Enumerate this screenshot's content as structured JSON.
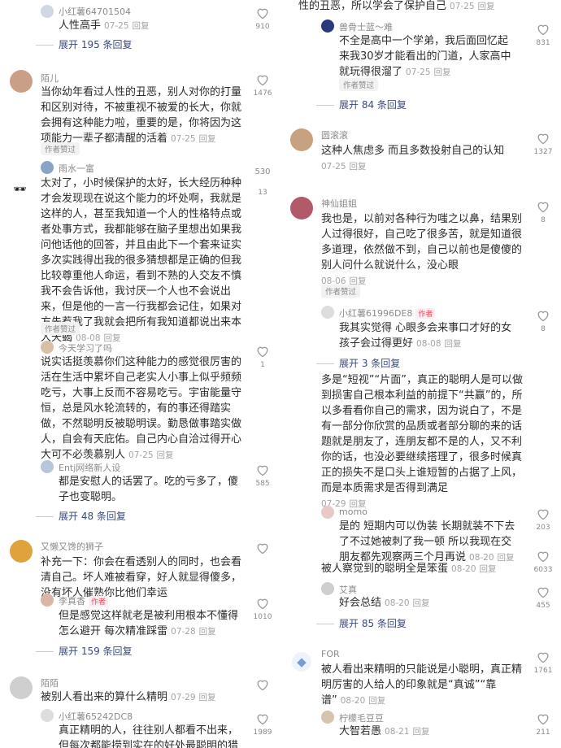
{
  "left": {
    "c0": {
      "name": "小红薯64701504",
      "text": "人性高手",
      "date": "07-25",
      "reply": "回复",
      "likes": "910",
      "expand": "展开 195 条回复"
    },
    "c1": {
      "name": "陌儿",
      "text": "当你幼年看过人性的丑恶，别人对你的打量和区别对待，不被重视不被爱的长大，你就会拥有这种能力啦，重要的是，你将因为这项能力一辈子都清醒的活着",
      "date": "07-25",
      "reply": "回复",
      "likes": "1476",
      "author_liked": "作者赞过"
    },
    "c2": {
      "name": "雨水一富",
      "text": "太对了，小时候保护的太好，长大经历种种才会发现现在说这个能力的坏处啊，我就是这样的人，甚至我知道一个人的性格特点或者处事方式，我都能够在脑子里想出如果我问他话他的回答，并且由此下一个套来证实多次实践得出我的很多猜想都是正确的但我比较尊重他人命运，看到不熟的人交友不慎我不会告诉他，我讨厌一个人也不会说出来，但是他的一言一行我都会记住，如果对方先惹我了我就会把所有我知道都说出来本人天蝎",
      "date": "08-08",
      "reply": "回复",
      "likes": "530",
      "likes2": "13",
      "author_liked": "作者赞过"
    },
    "c3": {
      "name": "今天学习了吗",
      "text": "说实话挺羡慕你们这种能力的感觉很厉害的活在生活中累坏自己老实人小事上似乎频频吃亏，大事上反而不容易吃亏。宇宙能量守恒，总是风水轮流转的，有的事还得踏实做，不然聪明反被聪明误。勤恳做事踏实做人，自会有天庇佑。自己内心自洽过得开心大可不必羡慕别人",
      "date": "07-25",
      "reply": "回复",
      "likes": "1"
    },
    "c4": {
      "name": "Entj网络新人设",
      "text": "都是安慰人的话罢了。吃的亏多了，傻子也变聪明。",
      "date": "",
      "likes": "585",
      "expand": "展开 48 条回复"
    },
    "c5": {
      "name": "又懒又馋的狮子",
      "text": "补充一下：你会在看透别人的同时，也会看清自己。坏人难被看穿，好人就显得傻多，没有坏人催熟你比他们幸运",
      "date": "",
      "likes": ""
    },
    "c6": {
      "name": "李真香",
      "author_badge": "作者",
      "text": "但是感觉这样就老是被利用根本不懂得怎么避开 每次精准踩雷",
      "date": "07-28",
      "reply": "回复",
      "likes": "1010",
      "expand": "展开 159 条回复"
    },
    "c7": {
      "name": "陌陌",
      "text": "被别人看出来的算什么精明",
      "date": "07-29",
      "reply": "回复",
      "likes": ""
    },
    "c8": {
      "name": "小红薯65242DC8",
      "text": "真正精明的人，往往别人都看不出来，但每次都能捞到实在的好处最聪明的猎",
      "likes": "1989"
    }
  },
  "right": {
    "c0": {
      "text": "性的丑恶，所以学会了保护自己",
      "date": "07-25",
      "reply": "回复"
    },
    "c1": {
      "name": "兽骨士蓝～难",
      "text": "不全是高中一个学弟，我后面回忆起来我30岁才能看出的门道，人家高中就玩得很溜了",
      "date": "07-25",
      "reply": "回复",
      "likes": "831",
      "author_liked": "作者赞过",
      "expand": "展开 84 条回复"
    },
    "c2": {
      "name": "圆滚滚",
      "text": "这种人焦虑多 而且多数投射自己的认知",
      "date": "07-25",
      "reply": "回复",
      "likes": "1327"
    },
    "c3": {
      "name": "神仙姐姐",
      "text": "我也是，以前对各种行为嗤之以鼻，结果别人过得很好，自己吃了很多苦，就是知道很多道理，依然做不到，自己以前也是傻傻的别人问什么就说什么，没心眼",
      "date": "08-06",
      "reply": "回复",
      "likes": "8",
      "author_liked": "作者赞过"
    },
    "c4": {
      "name": "小红薯61996DE8",
      "author_badge": "作者",
      "text": "我其实觉得 心眼多会来事口才好的女孩子会过得更好",
      "date": "08-08",
      "reply": "回复",
      "likes": "8",
      "expand": "展开 3 条回复"
    },
    "c5": {
      "text": "多是“短视”“片面”，真正的聪明人是可以做到损害自己根本利益的前提下“共赢”的，所以多看看你自己的需求，因为说白了，不是有一部分你欣赏的品质或者部分聊的来的话题就是朋友了，连朋友都不是的人，又不利你的话，也没必要继续搭理了，很多时候真正的损失不是口头上谁短暂的占据了上风，而是本质需求是否得到满足",
      "date": "07-29",
      "reply": "回复"
    },
    "c6": {
      "name": "momo",
      "text": "是的 短期内可以伪装 长期就装不下去了不过她被刺了我一顿 所以我现在交朋友都先观察两三个月再说",
      "date": "08-20",
      "reply": "回复",
      "likes": "203"
    },
    "c7": {
      "text": "被人察觉到的聪明全是笨蛋",
      "date": "08-20",
      "reply": "回复",
      "likes": "6033"
    },
    "c8": {
      "name": "艾真",
      "text": "好会总结",
      "date": "08-20",
      "reply": "回复",
      "likes": "455",
      "expand": "展开 85 条回复"
    },
    "c9": {
      "name": "FOR",
      "text": "被人看出来精明的只能说是小聪明，真正精明厉害的人给人的印象就是“真诚”“靠谱”",
      "date": "08-20",
      "reply": "回复",
      "likes": "1761"
    },
    "c10": {
      "name": "柠檬毛豆豆",
      "text": "大智若愚",
      "date": "08-21",
      "reply": "回复",
      "likes": "211"
    }
  }
}
